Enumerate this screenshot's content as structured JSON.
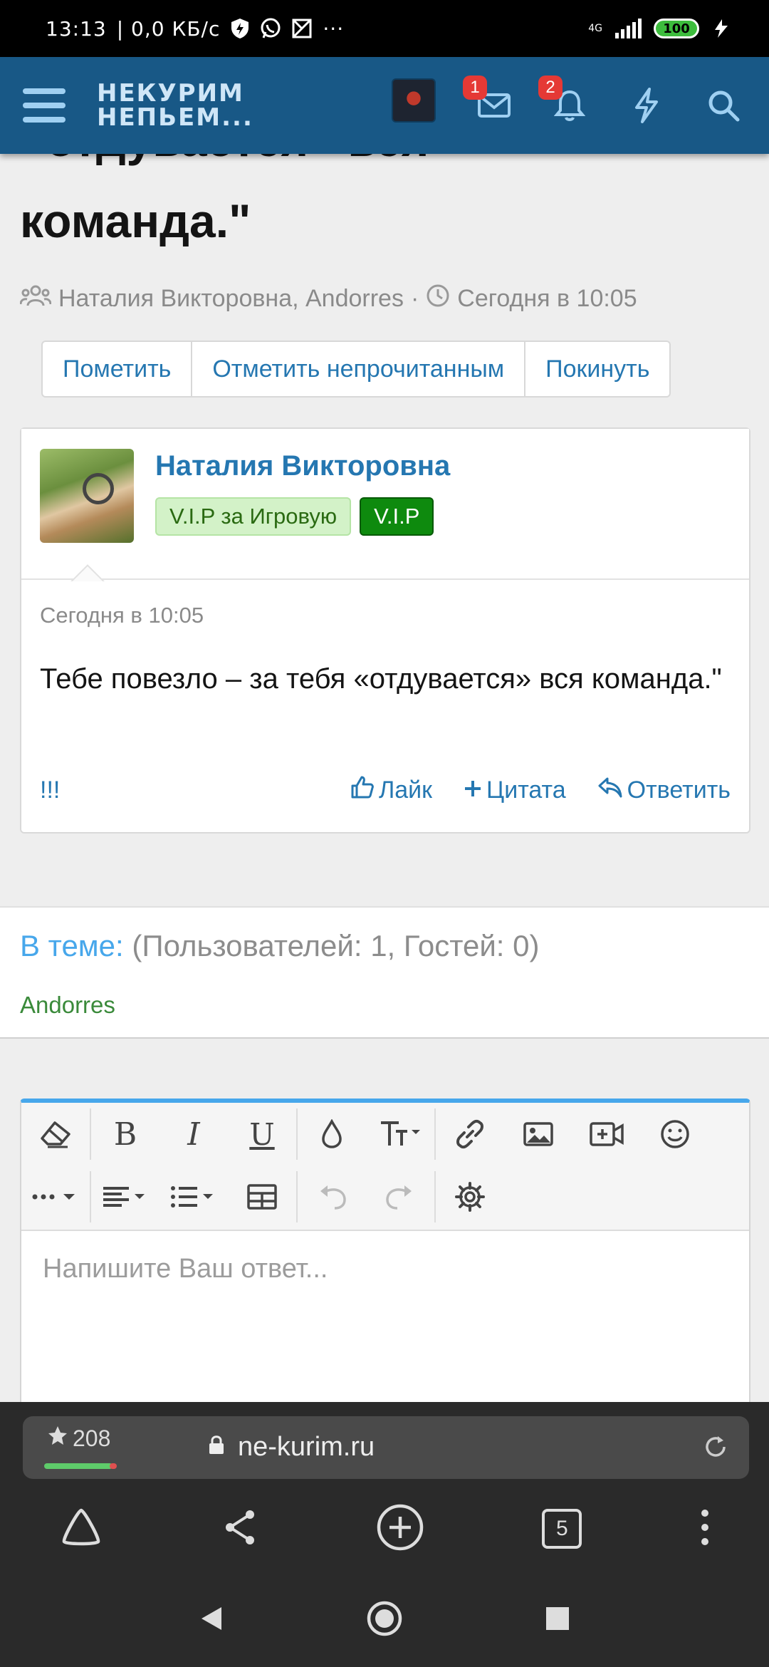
{
  "status_bar": {
    "time": "13:13",
    "speed": "| 0,0 КБ/с",
    "more": "···",
    "network": "4G",
    "battery": "100"
  },
  "header": {
    "logo_line1": "НЕКУРИМ",
    "logo_line2": "НЕПЬЕМ...",
    "messages_badge": "1",
    "alerts_badge": "2"
  },
  "thread": {
    "title_partial": "«отдувается» вся",
    "title_line": "команда.\"",
    "participants": "Наталия Викторовна, Andorres",
    "separator": "·",
    "date": "Сегодня в 10:05",
    "buttons": [
      "Пометить",
      "Отметить непрочитанным",
      "Покинуть"
    ]
  },
  "post": {
    "author": "Наталия Викторовна",
    "badge_1": "V.I.P за Игровую",
    "badge_2": "V.I.P",
    "date": "Сегодня в 10:05",
    "text": "Тебе повезло – за тебя «отдувается» вся команда.\"",
    "report": "!!!",
    "like": "Лайк",
    "quote": "Цитата",
    "reply": "Ответить"
  },
  "online": {
    "label": "В теме:",
    "counts": "(Пользователей: 1, Гостей: 0)",
    "user": "Andorres"
  },
  "editor": {
    "placeholder": "Напишите Ваш ответ..."
  },
  "browser": {
    "rating": "208",
    "url": "ne-kurim.ru",
    "tabs_count": "5"
  }
}
